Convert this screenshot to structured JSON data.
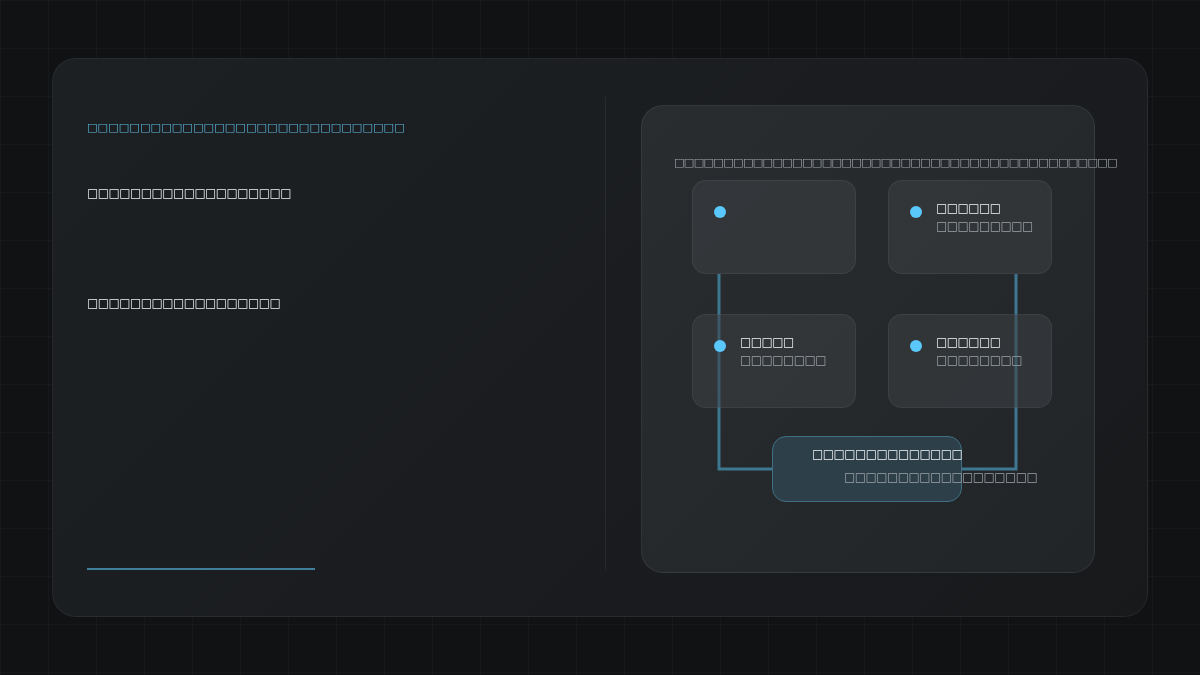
{
  "intro": {
    "eyebrow": "□□□□□□□□□□□□□□□□□□□□□□□□□□□□□□",
    "lines": [
      "□□□□□□□□□□□□□□□□□□□",
      "□□□□□□□□□□□□□□□□□□"
    ]
  },
  "diagram": {
    "caption": "□□□□□□□□□□□□□□□□□□□□□□□□□□□□□□□□□□□□□□□□□□□□□",
    "nodes": [
      {
        "kind": "blank"
      },
      {
        "kind": "labeled",
        "title": "□□□□□□",
        "subtitle": "□□□□□□□□□"
      },
      {
        "kind": "labeled",
        "title": "□□□□□",
        "subtitle": "□□□□□□□□"
      },
      {
        "kind": "labeled",
        "title": "□□□□□□",
        "subtitle": "□□□□□□□□"
      }
    ],
    "hub": {
      "title": "□□□□□□□□□□□□□□",
      "subtitle": "□□□□□□□□□□□□□□□□□□"
    }
  }
}
